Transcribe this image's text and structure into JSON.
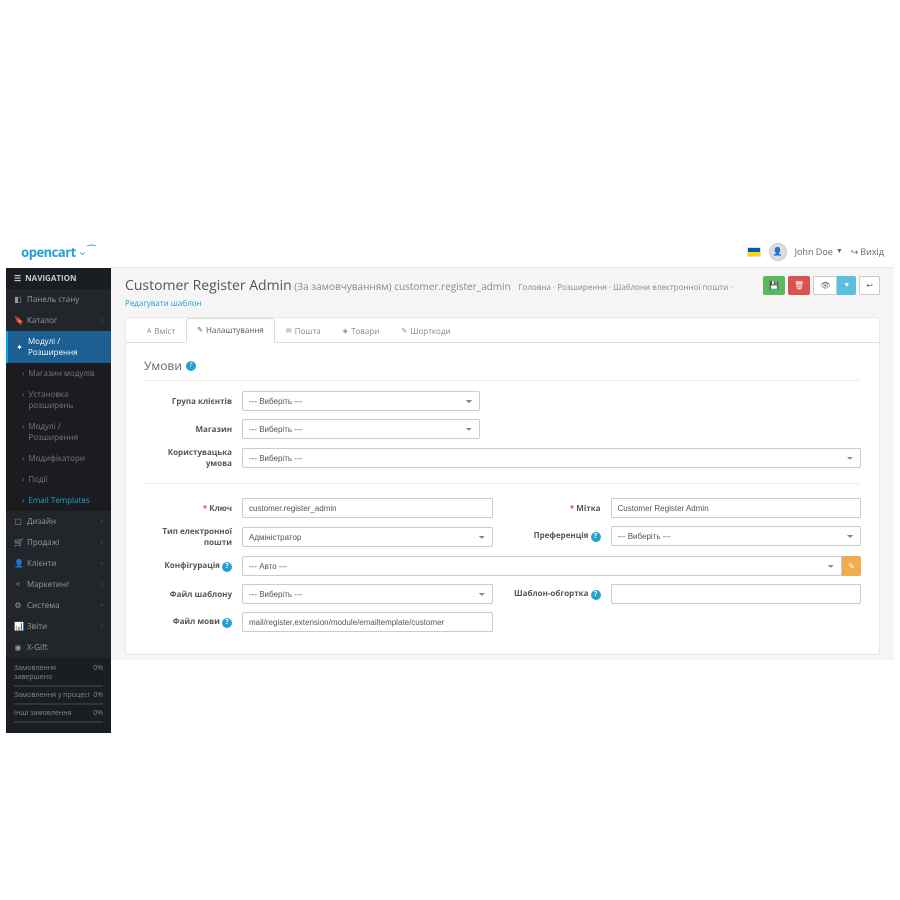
{
  "logo": "opencart",
  "user": {
    "name": "John Doe",
    "logout": "Вихід"
  },
  "sidebar": {
    "header": "NAVIGATION",
    "items": [
      {
        "icon": "◧",
        "label": "Панель стану"
      },
      {
        "icon": "🔖",
        "label": "Каталог",
        "expand": true
      },
      {
        "icon": "✦",
        "label": "Модулі / Розширення",
        "active": true,
        "children": [
          {
            "label": "Магазин модулів"
          },
          {
            "label": "Установка розширень"
          },
          {
            "label": "Модулі / Розширення"
          },
          {
            "label": "Модифікатори"
          },
          {
            "label": "Події"
          },
          {
            "label": "Email Templates",
            "active": true
          }
        ]
      },
      {
        "icon": "▢",
        "label": "Дизайн",
        "expand": true
      },
      {
        "icon": "🛒",
        "label": "Продажі",
        "expand": true
      },
      {
        "icon": "👤",
        "label": "Клієнти",
        "expand": true
      },
      {
        "icon": "<",
        "label": "Маркетинг",
        "expand": true
      },
      {
        "icon": "⚙",
        "label": "Система",
        "expand": true
      },
      {
        "icon": "📊",
        "label": "Звіти",
        "expand": true
      },
      {
        "icon": "◉",
        "label": "X-Gift"
      }
    ],
    "stats": [
      {
        "label": "Замовлення завершено",
        "value": "0%"
      },
      {
        "label": "Замовлення у процесі",
        "value": "0%"
      },
      {
        "label": "Інші замовлення",
        "value": "0%"
      }
    ]
  },
  "page": {
    "title": "Customer Register Admin",
    "subtitle": "(За замовчуванням)",
    "code": "customer.register_admin",
    "breadcrumb": [
      "Головна",
      "Розширення",
      "Шаблони електронної пошти"
    ],
    "breadcrumb_active": "Редагувати шаблон"
  },
  "tabs": [
    {
      "icon": "A",
      "label": "Вміст"
    },
    {
      "icon": "✎",
      "label": "Налаштування",
      "active": true
    },
    {
      "icon": "✉",
      "label": "Пошта"
    },
    {
      "icon": "◈",
      "label": "Товари"
    },
    {
      "icon": "✎",
      "label": "Шорткоди"
    }
  ],
  "section": {
    "title": "Умови"
  },
  "form": {
    "group_label": "Група клієнтів",
    "store_label": "Магазин",
    "condition_label": "Користувацька умова",
    "select_placeholder": "--- Виберіть ---",
    "key_label": "Ключ",
    "key_value": "customer.register_admin",
    "label_label": "Мітка",
    "label_value": "Customer Register Admin",
    "email_type_label": "Тип електронної пошти",
    "email_type_value": "Адміністратор",
    "pref_label": "Преференція",
    "pref_value": "--- Виберіть ---",
    "config_label": "Конфігурація",
    "config_value": "--- Авто ---",
    "template_file_label": "Файл шаблону",
    "wrapper_label": "Шаблон-обгортка",
    "lang_file_label": "Файл мови",
    "lang_file_value": "mail/register,extension/module/emailtemplate/customer"
  }
}
